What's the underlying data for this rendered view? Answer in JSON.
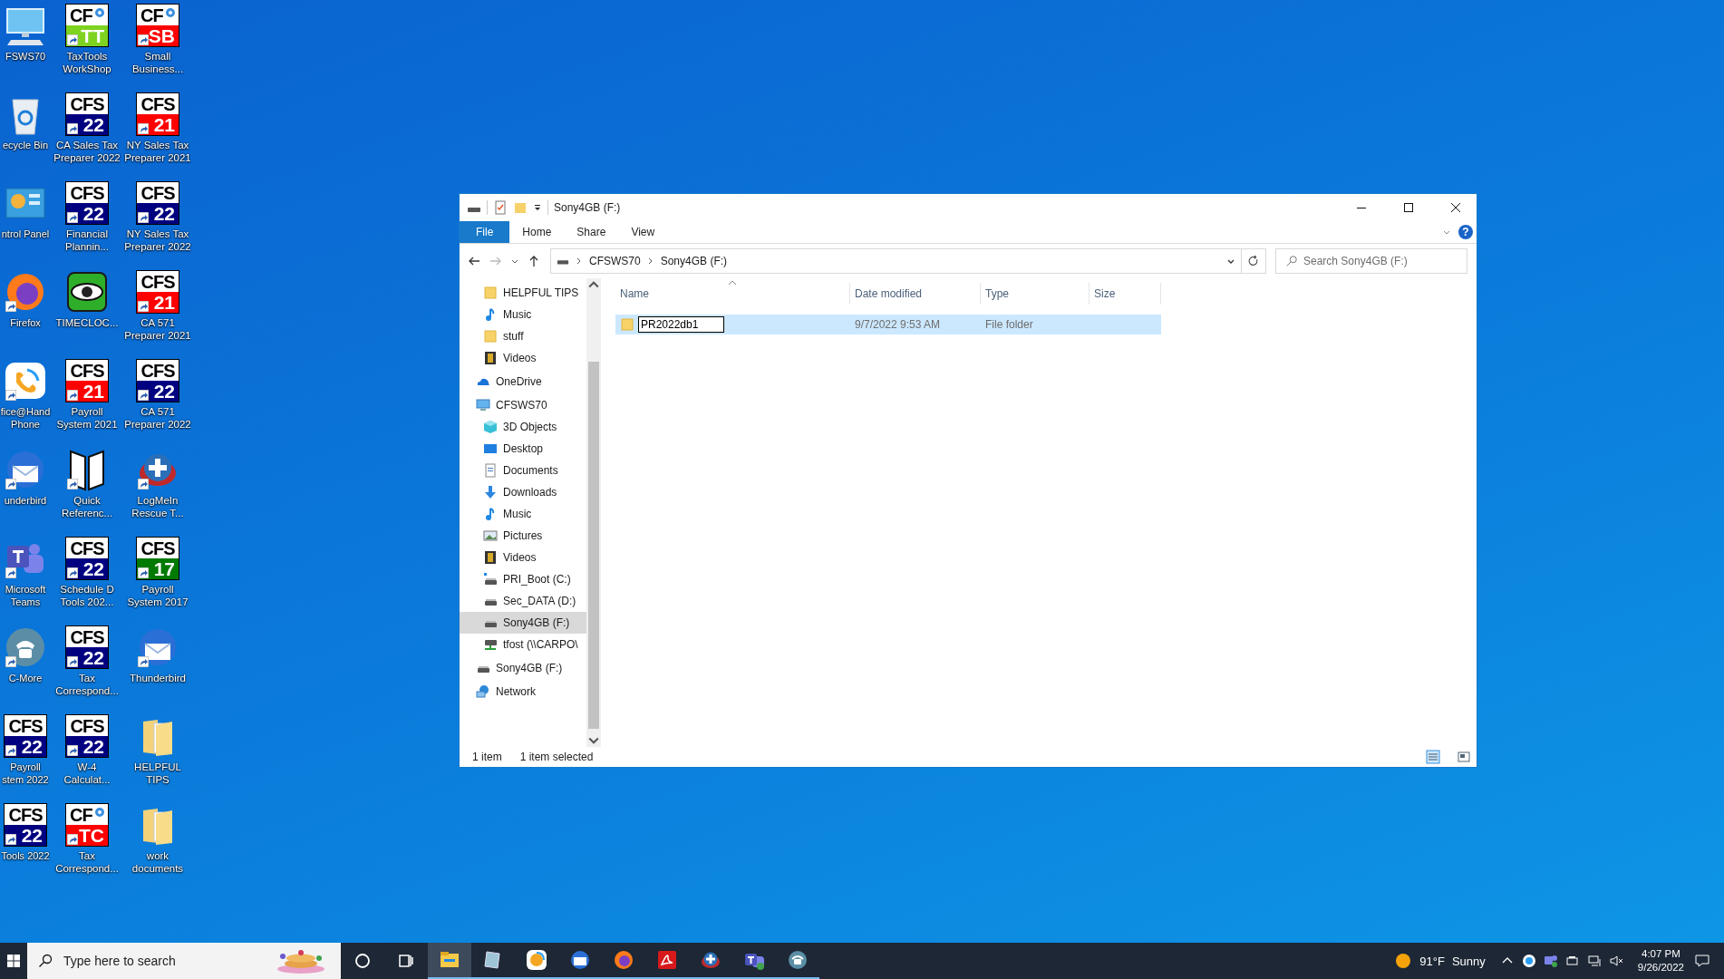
{
  "desktop": {
    "columns": [
      [
        {
          "label": "FSWS70",
          "kind": "monitor",
          "shortcut": false
        },
        {
          "label": "ecycle Bin",
          "kind": "recycle",
          "shortcut": false
        },
        {
          "label": "ntrol Panel",
          "kind": "control",
          "shortcut": false
        },
        {
          "label": "Firefox",
          "kind": "firefox",
          "shortcut": true
        },
        {
          "label": "fice@Hand\nPhone",
          "kind": "officehand",
          "shortcut": true
        },
        {
          "label": "underbird",
          "kind": "thunderbird",
          "shortcut": true
        },
        {
          "label": "Microsoft\nTeams",
          "kind": "teams",
          "shortcut": true
        },
        {
          "label": "C-More",
          "kind": "cmore",
          "shortcut": true
        },
        {
          "label": "Payroll\nstem 2022",
          "kind": "cfs",
          "logo": "CFS",
          "badge": "22",
          "color": "#000080",
          "shortcut": true
        },
        {
          "label": "Tools 2022",
          "kind": "cfs",
          "logo": "CFS",
          "badge": "22",
          "color": "#000080",
          "shortcut": true
        }
      ],
      [
        {
          "label": "TaxTools\nWorkShop",
          "kind": "cfs_gear",
          "logo": "CF",
          "badge": "TT",
          "color": "#7ed321",
          "shortcut": true
        },
        {
          "label": "CA Sales Tax\nPreparer 2022",
          "kind": "cfs",
          "logo": "CFS",
          "badge": "22",
          "color": "#000080",
          "shortcut": true
        },
        {
          "label": "Financial\nPlannin...",
          "kind": "cfs",
          "logo": "CFS",
          "badge": "22",
          "color": "#000080",
          "shortcut": true
        },
        {
          "label": "TIMECLOC...",
          "kind": "eye",
          "shortcut": false
        },
        {
          "label": "Payroll\nSystem 2021",
          "kind": "cfs",
          "logo": "CFS",
          "badge": "21",
          "color": "#ff0000",
          "shortcut": true
        },
        {
          "label": "Quick\nReferenc...",
          "kind": "book",
          "shortcut": true
        },
        {
          "label": "Schedule D\nTools 202...",
          "kind": "cfs",
          "logo": "CFS",
          "badge": "22",
          "color": "#000080",
          "shortcut": true
        },
        {
          "label": "Tax\nCorrespond...",
          "kind": "cfs",
          "logo": "CFS",
          "badge": "22",
          "color": "#000080",
          "shortcut": true
        },
        {
          "label": "W-4\nCalculat...",
          "kind": "cfs",
          "logo": "CFS",
          "badge": "22",
          "color": "#000080",
          "shortcut": true
        },
        {
          "label": "Tax\nCorrespond...",
          "kind": "cfs_gear",
          "logo": "CF",
          "badge": "TC",
          "color": "#ff0000",
          "shortcut": true
        }
      ],
      [
        {
          "label": "Small\nBusiness...",
          "kind": "cfs_gear",
          "logo": "CF",
          "badge": "SB",
          "color": "#ff0000",
          "shortcut": true
        },
        {
          "label": "NY Sales Tax\nPreparer 2021",
          "kind": "cfs",
          "logo": "CFS",
          "badge": "21",
          "color": "#ff0000",
          "shortcut": true
        },
        {
          "label": "NY Sales Tax\nPreparer 2022",
          "kind": "cfs",
          "logo": "CFS",
          "badge": "22",
          "color": "#000080",
          "shortcut": true
        },
        {
          "label": "CA 571\nPreparer 2021",
          "kind": "cfs",
          "logo": "CFS",
          "badge": "21",
          "color": "#ff0000",
          "shortcut": true
        },
        {
          "label": "CA 571\nPreparer 2022",
          "kind": "cfs",
          "logo": "CFS",
          "badge": "22",
          "color": "#000080",
          "shortcut": true
        },
        {
          "label": "LogMeIn\nRescue T...",
          "kind": "logmein",
          "shortcut": true
        },
        {
          "label": "Payroll\nSystem 2017",
          "kind": "cfs",
          "logo": "CFS",
          "badge": "17",
          "color": "#007a00",
          "shortcut": true
        },
        {
          "label": "Thunderbird",
          "kind": "thunderbird",
          "shortcut": true
        },
        {
          "label": "HELPFUL\nTIPS",
          "kind": "folder",
          "shortcut": false
        },
        {
          "label": "work\ndocuments",
          "kind": "folder",
          "shortcut": false
        }
      ]
    ]
  },
  "explorer": {
    "title": "Sony4GB (F:)",
    "ribbon_tabs": [
      {
        "label": "File",
        "kind": "file"
      },
      {
        "label": "Home",
        "kind": "tab"
      },
      {
        "label": "Share",
        "kind": "tab"
      },
      {
        "label": "View",
        "kind": "tab"
      }
    ],
    "help": "?",
    "address": [
      "CFSWS70",
      "Sony4GB (F:)"
    ],
    "search": {
      "placeholder": "Search Sony4GB (F:)"
    },
    "nav": {
      "quick_access": [
        {
          "label": "HELPFUL TIPS",
          "kind": "folder",
          "selected": false
        },
        {
          "label": "Music",
          "kind": "music",
          "selected": false
        },
        {
          "label": "stuff",
          "kind": "folder",
          "selected": false
        },
        {
          "label": "Videos",
          "kind": "video",
          "selected": false
        }
      ],
      "items": [
        {
          "label": "OneDrive",
          "kind": "onedrive",
          "selected": false
        },
        {
          "label": "CFSWS70",
          "kind": "pc",
          "selected": false,
          "children": [
            {
              "label": "3D Objects",
              "kind": "cube",
              "selected": false
            },
            {
              "label": "Desktop",
              "kind": "desktop",
              "selected": false
            },
            {
              "label": "Documents",
              "kind": "docs",
              "selected": false
            },
            {
              "label": "Downloads",
              "kind": "download",
              "selected": false
            },
            {
              "label": "Music",
              "kind": "music",
              "selected": false
            },
            {
              "label": "Pictures",
              "kind": "pictures",
              "selected": false
            },
            {
              "label": "Videos",
              "kind": "video",
              "selected": false
            },
            {
              "label": "PRI_Boot (C:)",
              "kind": "windrive",
              "selected": false
            },
            {
              "label": "Sec_DATA (D:)",
              "kind": "drive",
              "selected": false
            },
            {
              "label": "Sony4GB (F:)",
              "kind": "drive",
              "selected": true
            },
            {
              "label": "tfost (\\\\CARPO\\",
              "kind": "netdrive",
              "selected": false
            }
          ]
        },
        {
          "label": "Sony4GB (F:)",
          "kind": "drive",
          "selected": false
        },
        {
          "label": "Network",
          "kind": "network",
          "selected": false
        }
      ]
    },
    "columns": [
      "Name",
      "Date modified",
      "Type",
      "Size"
    ],
    "rows": [
      {
        "name": "PR2022db1",
        "date": "9/7/2022 9:53 AM",
        "type": "File folder",
        "selected": true,
        "editing": true
      }
    ],
    "status": [
      "1 item",
      "1 item selected"
    ]
  },
  "taskbar": {
    "search": {
      "placeholder": "Type here to search"
    },
    "apps": [
      {
        "kind": "explorer",
        "active": true
      },
      {
        "kind": "notes",
        "active": false
      },
      {
        "kind": "officehand",
        "active": false
      },
      {
        "kind": "thunderbird",
        "active": false
      },
      {
        "kind": "firefox",
        "active": false
      },
      {
        "kind": "acrobat",
        "active": false
      },
      {
        "kind": "logmein",
        "active": false
      },
      {
        "kind": "teams",
        "active": false
      },
      {
        "kind": "cmore",
        "active": false
      }
    ],
    "weather": {
      "temp": "91°F",
      "condition": "Sunny"
    },
    "time": "4:07 PM",
    "date": "9/26/2022"
  }
}
